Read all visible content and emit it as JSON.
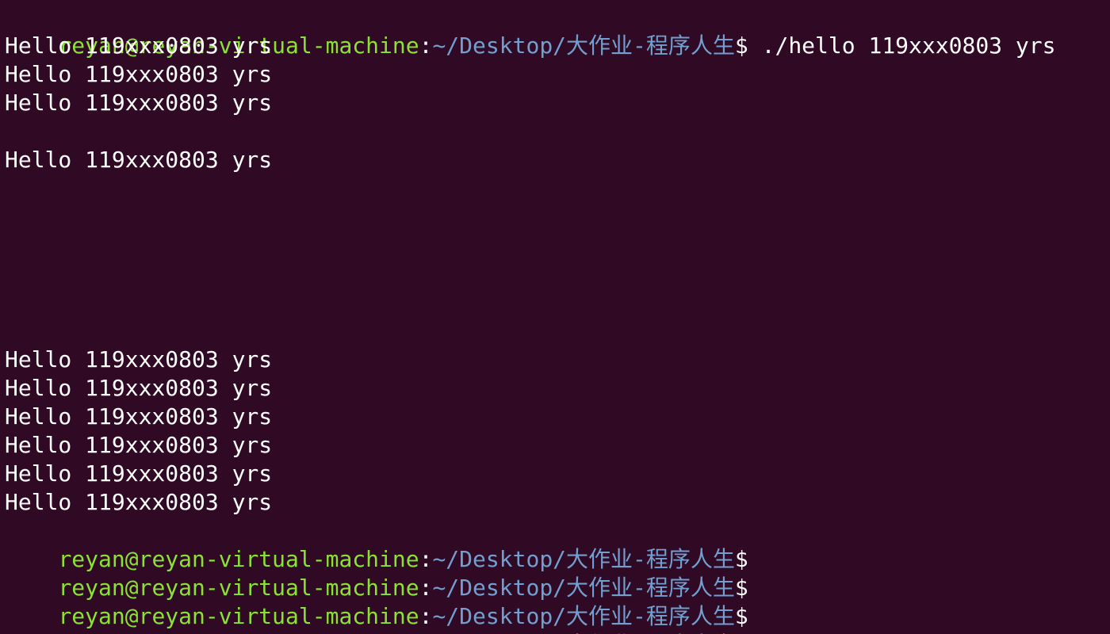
{
  "colors": {
    "background": "#300a24",
    "prompt_user": "#8ae234",
    "prompt_path": "#729fcf",
    "text": "#ffffff"
  },
  "prompt": {
    "user_host": "reyan@reyan-virtual-machine",
    "separator": ":",
    "path": "~/Desktop/大作业-程序人生",
    "symbol": "$"
  },
  "command": " ./hello 119xxx0803 yrs",
  "output": {
    "block1": [
      "Hello 119xxx0803 yrs",
      "Hello 119xxx0803 yrs",
      "Hello 119xxx0803 yrs"
    ],
    "block2": [
      "Hello 119xxx0803 yrs"
    ],
    "block3": [
      "Hello 119xxx0803 yrs",
      "Hello 119xxx0803 yrs",
      "Hello 119xxx0803 yrs",
      "Hello 119xxx0803 yrs",
      "Hello 119xxx0803 yrs",
      "Hello 119xxx0803 yrs"
    ]
  }
}
